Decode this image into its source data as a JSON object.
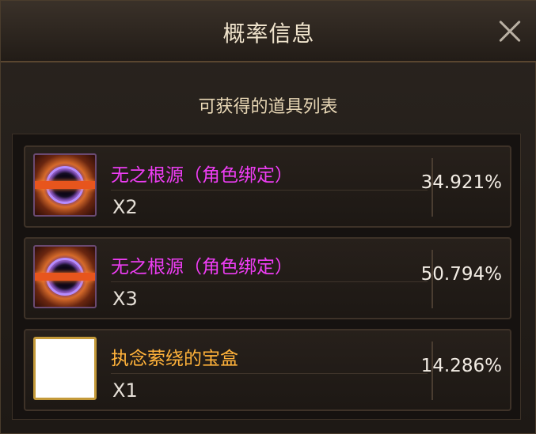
{
  "header": {
    "title": "概率信息"
  },
  "subtitle": "可获得的道具列表",
  "items": [
    {
      "name": "无之根源（角色绑定）",
      "qty": "X2",
      "percent": "34.921%",
      "icon": "vortex-icon",
      "color": "#ee3df4"
    },
    {
      "name": "无之根源（角色绑定）",
      "qty": "X3",
      "percent": "50.794%",
      "icon": "vortex-icon",
      "color": "#ee3df4"
    },
    {
      "name": "执念萦绕的宝盒",
      "qty": "X1",
      "percent": "14.286%",
      "icon": "chest-icon",
      "color": "#ffb23a"
    }
  ]
}
